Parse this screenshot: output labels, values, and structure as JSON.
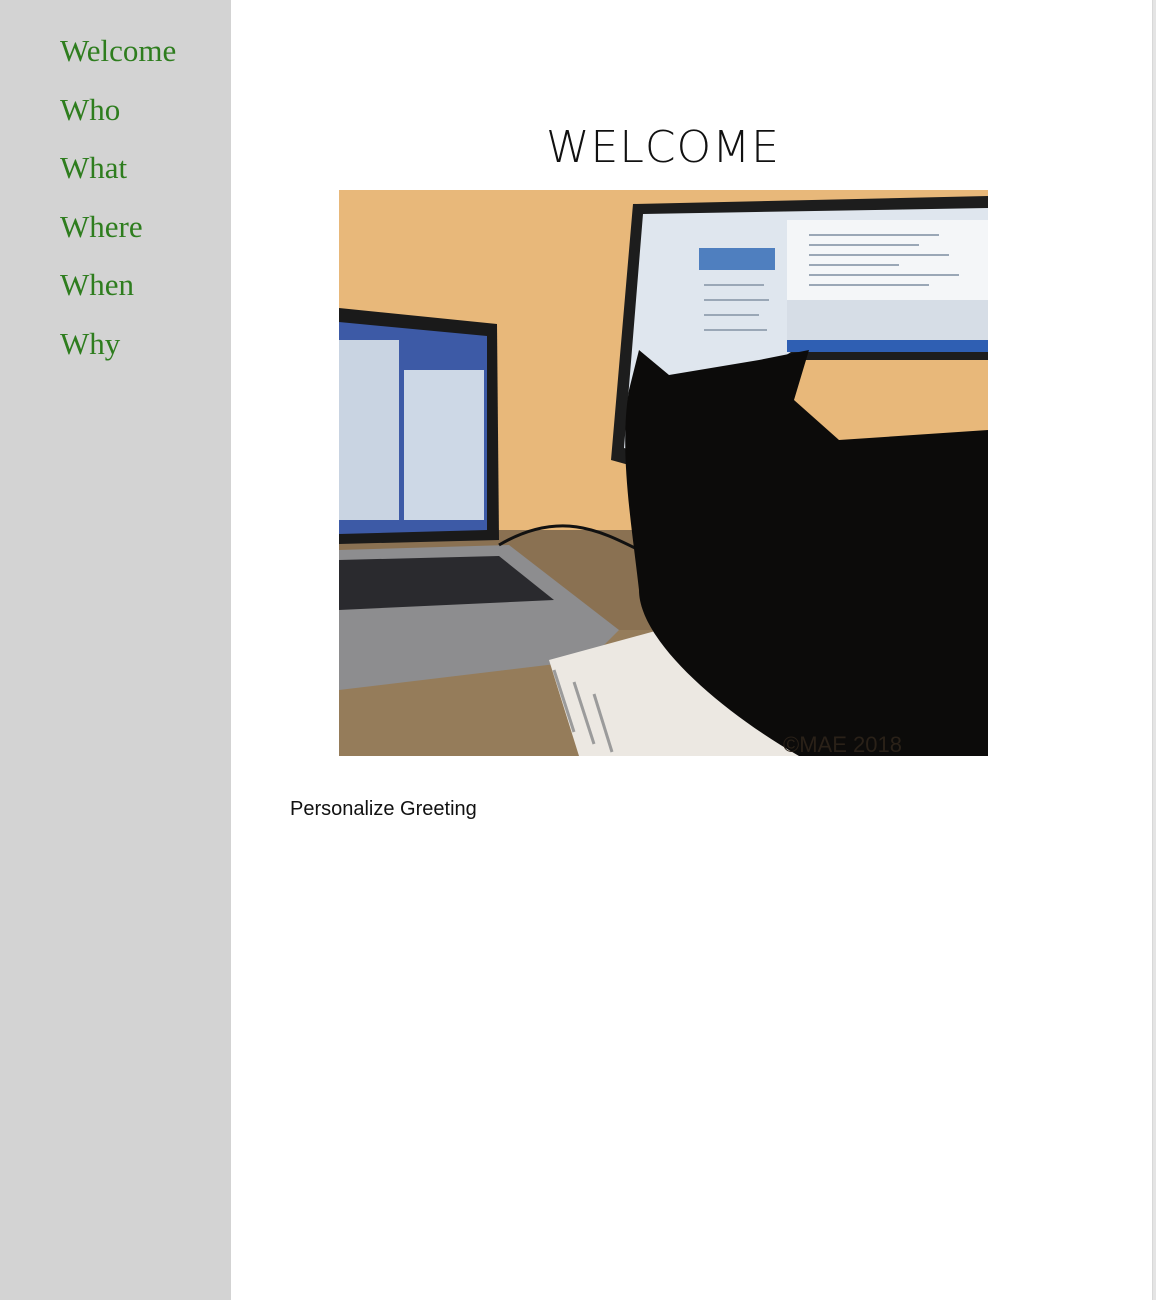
{
  "sidebar": {
    "items": [
      {
        "label": "Welcome"
      },
      {
        "label": "Who"
      },
      {
        "label": "What"
      },
      {
        "label": "Where"
      },
      {
        "label": "When"
      },
      {
        "label": "Why"
      }
    ],
    "link_color": "#2e7d1e",
    "background": "#d3d3d3"
  },
  "main": {
    "title": "WELCOME",
    "photo": {
      "description": "Black cat sitting in front of a computer monitor next to a laptop and a spiral notebook",
      "watermark": "©MAE 2018"
    },
    "greeting_link": "Personalize Greeting"
  }
}
